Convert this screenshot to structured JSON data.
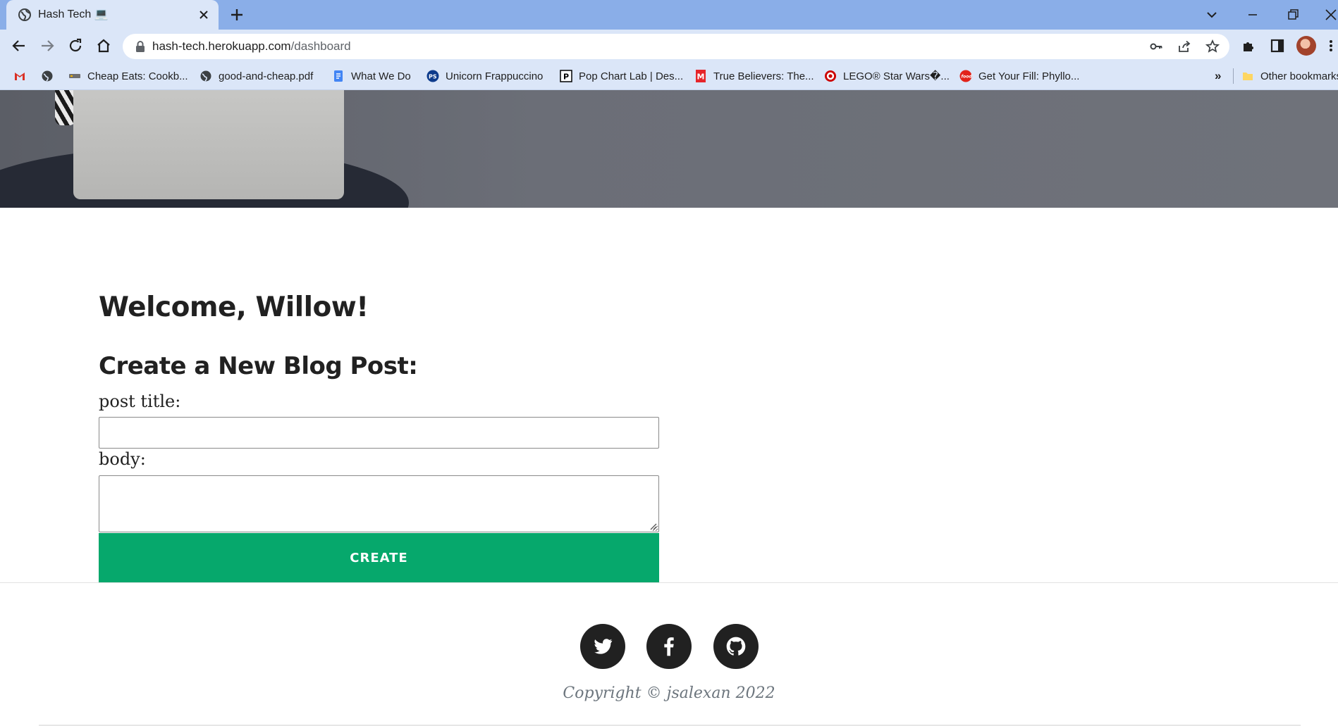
{
  "browser": {
    "tab_title": "Hash Tech 💻",
    "url_host": "hash-tech.herokuapp.com",
    "url_path": "/dashboard",
    "bookmarks": [
      {
        "label": "",
        "icon": "gmail-icon"
      },
      {
        "label": "",
        "icon": "globe-icon"
      },
      {
        "label": "Cheap Eats: Cookb...",
        "icon": "site-icon"
      },
      {
        "label": "good-and-cheap.pdf",
        "icon": "globe-icon"
      },
      {
        "label": "What We Do",
        "icon": "docs-icon"
      },
      {
        "label": "Unicorn Frappuccino",
        "icon": "ps-icon"
      },
      {
        "label": "Pop Chart Lab | Des...",
        "icon": "popchart-icon"
      },
      {
        "label": "True Believers: The...",
        "icon": "marvel-icon"
      },
      {
        "label": "LEGO® Star Wars�...",
        "icon": "target-icon"
      },
      {
        "label": "Get Your Fill: Phyllo...",
        "icon": "food-icon"
      }
    ],
    "more_bookmarks": "»",
    "other_bookmarks": "Other bookmarks"
  },
  "page": {
    "welcome": "Welcome, Willow!",
    "create_heading": "Create a New Blog Post:",
    "title_label": "post title:",
    "title_value": "",
    "body_label": "body:",
    "body_value": "",
    "create_button": "CREATE",
    "copyright": "Copyright © jsalexan 2022"
  },
  "colors": {
    "accent": "#06a86c",
    "tabstrip": "#8aaee8",
    "toolbar": "#dbe6f8",
    "text_dark": "#212121"
  }
}
